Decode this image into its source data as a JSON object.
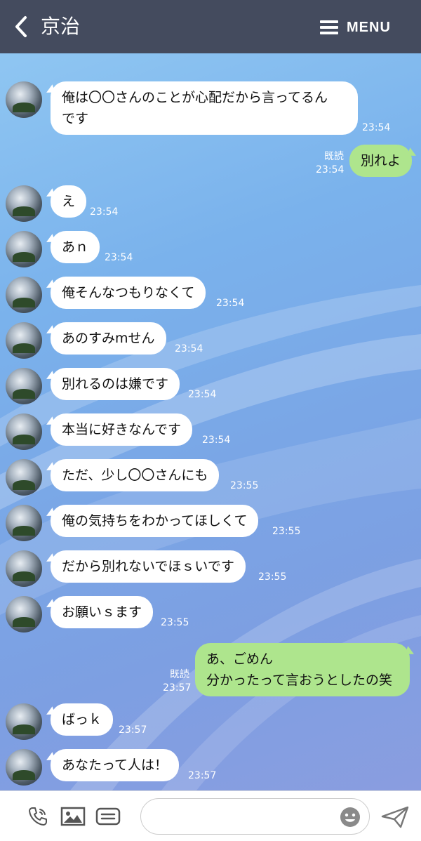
{
  "header": {
    "title": "京治",
    "menu_label": "MENU"
  },
  "messages": [
    {
      "side": "in",
      "lines": [
        "俺は〇〇さんのことが心配だから言ってるん",
        "です"
      ],
      "time": "23:54"
    },
    {
      "side": "out",
      "lines": [
        "別れよ"
      ],
      "time": "23:54",
      "read": "既読"
    },
    {
      "side": "in",
      "lines": [
        "え"
      ],
      "time": "23:54"
    },
    {
      "side": "in",
      "lines": [
        "あｎ"
      ],
      "time": "23:54"
    },
    {
      "side": "in",
      "lines": [
        "俺そんなつもりなくて"
      ],
      "time": "23:54"
    },
    {
      "side": "in",
      "lines": [
        "あのすみmせん"
      ],
      "time": "23:54"
    },
    {
      "side": "in",
      "lines": [
        "別れるのは嫌です"
      ],
      "time": "23:54"
    },
    {
      "side": "in",
      "lines": [
        "本当に好きなんです"
      ],
      "time": "23:54"
    },
    {
      "side": "in",
      "lines": [
        "ただ、少し〇〇さんにも"
      ],
      "time": "23:55"
    },
    {
      "side": "in",
      "lines": [
        "俺の気持ちをわかってほしくて"
      ],
      "time": "23:55"
    },
    {
      "side": "in",
      "lines": [
        "だから別れないでほｓいです"
      ],
      "time": "23:55"
    },
    {
      "side": "in",
      "lines": [
        "お願いｓます"
      ],
      "time": "23:55"
    },
    {
      "side": "out",
      "lines": [
        "あ、ごめん",
        "分かったって言おうとしたの笑"
      ],
      "time": "23:57",
      "read": "既読"
    },
    {
      "side": "in",
      "lines": [
        "ばっｋ"
      ],
      "time": "23:57"
    },
    {
      "side": "in",
      "lines": [
        "あなたって人は！"
      ],
      "time": "23:57"
    }
  ],
  "footer": {
    "input_value": "",
    "icons": [
      "phone-icon",
      "image-icon",
      "sticker-card-icon",
      "emoji-icon",
      "send-icon"
    ]
  },
  "colors": {
    "header_bg": "#444b5e",
    "bubble_in": "#ffffff",
    "bubble_out": "#aee58d"
  }
}
